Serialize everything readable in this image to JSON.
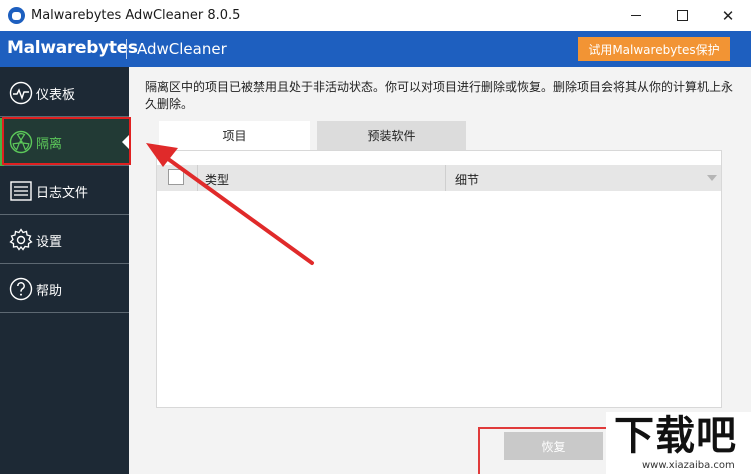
{
  "window": {
    "title": "Malwarebytes AdwCleaner 8.0.5",
    "icon": "malwarebytes-shield-icon"
  },
  "header": {
    "brand": "Malwarebytes",
    "product": "AdwCleaner",
    "trial_button": "试用Malwarebytes保护",
    "colors": {
      "header": "#1e5fbf",
      "trial": "#f29434"
    }
  },
  "sidebar": {
    "items": [
      {
        "label": "仪表板",
        "icon": "dashboard-pulse-icon"
      },
      {
        "label": "隔离",
        "icon": "quarantine-radiation-icon",
        "active": true
      },
      {
        "label": "日志文件",
        "icon": "log-file-icon"
      },
      {
        "label": "设置",
        "icon": "gear-icon"
      },
      {
        "label": "帮助",
        "icon": "help-question-icon"
      }
    ],
    "colors": {
      "bg": "#1d2935",
      "active_text": "#5cc85a"
    }
  },
  "main": {
    "description": "隔离区中的项目已被禁用且处于非活动状态。你可以对项目进行删除或恢复。删除项目会将其从你的计算机上永久删除。",
    "tabs": [
      {
        "label": "项目",
        "selected": true
      },
      {
        "label": "预装软件",
        "selected": false
      }
    ],
    "table": {
      "columns": [
        "类型",
        "细节"
      ],
      "rows": []
    },
    "restore_button": "恢复"
  },
  "watermark": {
    "text": "下载吧",
    "url": "www.xiazaiba.com"
  }
}
